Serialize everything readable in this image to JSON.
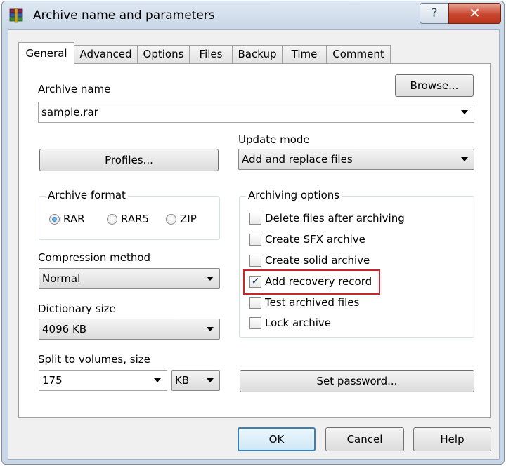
{
  "window": {
    "title": "Archive name and parameters",
    "help_glyph": "?",
    "close_glyph": "✕"
  },
  "tabs": [
    {
      "label": "General",
      "active": true
    },
    {
      "label": "Advanced"
    },
    {
      "label": "Options"
    },
    {
      "label": "Files"
    },
    {
      "label": "Backup"
    },
    {
      "label": "Time"
    },
    {
      "label": "Comment"
    }
  ],
  "general": {
    "archive_name_label": "Archive name",
    "browse_label": "Browse...",
    "archive_name_value": "sample.rar",
    "update_mode_label": "Update mode",
    "update_mode_value": "Add and replace files",
    "profiles_label": "Profiles...",
    "archive_format": {
      "title": "Archive format",
      "options": [
        {
          "label": "RAR",
          "selected": true
        },
        {
          "label": "RAR5",
          "selected": false
        },
        {
          "label": "ZIP",
          "selected": false
        }
      ]
    },
    "compression_method_label": "Compression method",
    "compression_method_value": "Normal",
    "dictionary_size_label": "Dictionary size",
    "dictionary_size_value": "4096 KB",
    "split_label": "Split to volumes, size",
    "split_value": "175",
    "split_unit": "KB",
    "archiving_options": {
      "title": "Archiving options",
      "items": [
        {
          "label": "Delete files after archiving",
          "checked": false
        },
        {
          "label": "Create SFX archive",
          "checked": false
        },
        {
          "label": "Create solid archive",
          "checked": false
        },
        {
          "label": "Add recovery record",
          "checked": true,
          "highlighted": true
        },
        {
          "label": "Test archived files",
          "checked": false
        },
        {
          "label": "Lock archive",
          "checked": false
        }
      ]
    },
    "set_password_label": "Set password...",
    "highlight_color": "#c8262a"
  },
  "footer": {
    "ok_label": "OK",
    "cancel_label": "Cancel",
    "help_label": "Help"
  }
}
